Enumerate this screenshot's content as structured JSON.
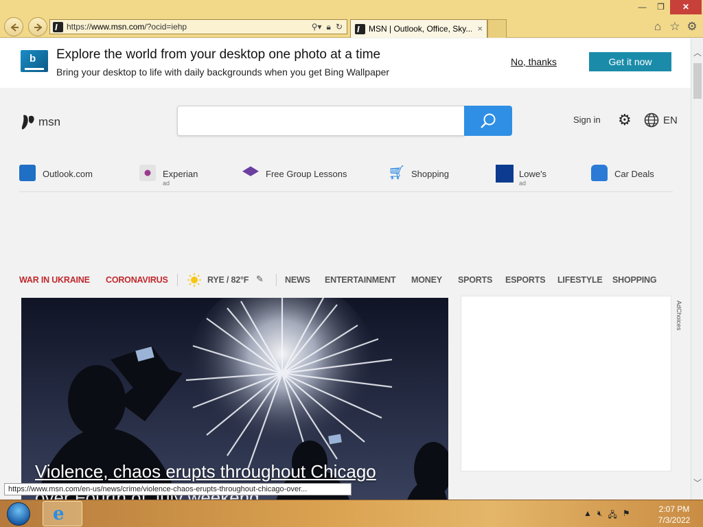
{
  "browser": {
    "url_prefix": "https://",
    "url_host": "www.msn.com",
    "url_rest": "/?ocid=iehp",
    "tab_title": "MSN | Outlook, Office, Sky...",
    "tab_close": "×",
    "minimize": "—",
    "maximize": "❐",
    "close": "✕"
  },
  "banner": {
    "title": "Explore the world from your desktop one photo at a time",
    "subtitle": "Bring your desktop to life with daily backgrounds when you get Bing Wallpaper",
    "no_thanks": "No, thanks",
    "get_it": "Get it now"
  },
  "header": {
    "logo_text": "msn",
    "search_placeholder": "",
    "sign_in": "Sign in",
    "language": "EN"
  },
  "quicklinks": [
    {
      "label": "Outlook.com",
      "ad": "",
      "icon": "outlook-icon",
      "color": "#1f6fc5"
    },
    {
      "label": "Experian",
      "ad": "ad",
      "icon": "experian-icon",
      "color": "#9b3a8d"
    },
    {
      "label": "Free Group Lessons",
      "ad": "",
      "icon": "graduation-cap-icon",
      "color": "#6b3fa0"
    },
    {
      "label": "Shopping",
      "ad": "",
      "icon": "shopping-cart-icon",
      "color": "#1b7ee0"
    },
    {
      "label": "Lowe's",
      "ad": "ad",
      "icon": "lowes-icon",
      "color": "#0c3b8f"
    },
    {
      "label": "Car Deals",
      "ad": "",
      "icon": "car-icon",
      "color": "#2b7bd6"
    }
  ],
  "catnav": {
    "war": "WAR IN UKRAINE",
    "corona": "CORONAVIRUS",
    "weather": "RYE / 82°F",
    "items": [
      "NEWS",
      "ENTERTAINMENT",
      "MONEY",
      "SPORTS",
      "ESPORTS",
      "LIFESTYLE",
      "SHOPPING"
    ]
  },
  "hero": {
    "title": "Violence, chaos erupts throughout Chicago",
    "title_line2": "over Fourth of July weekend"
  },
  "ad": {
    "adchoices": "AdChoices"
  },
  "status_url": "https://www.msn.com/en-us/news/crime/violence-chaos-erupts-throughout-chicago-over...",
  "taskbar": {
    "time": "2:07 PM",
    "date": "7/3/2022"
  },
  "colors": {
    "accent": "#2f8fe4",
    "banner_button": "#1a8caa",
    "alert_red": "#c0282d"
  }
}
